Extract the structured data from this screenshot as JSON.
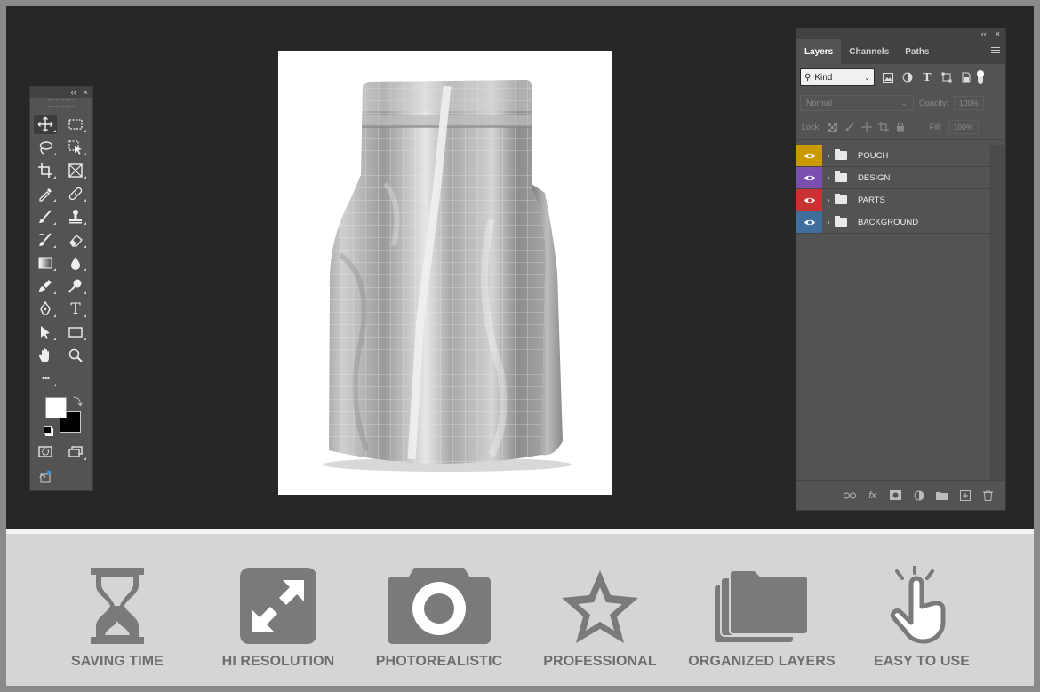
{
  "toolbar": {
    "collapse_glyph": "‹‹",
    "close_glyph": "×",
    "tools": [
      "move-tool",
      "rectangular-marquee-tool",
      "lasso-tool",
      "object-selection-tool",
      "crop-tool",
      "frame-tool",
      "eyedropper-tool",
      "spot-healing-tool",
      "brush-tool",
      "clone-stamp-tool",
      "history-brush-tool",
      "eraser-tool",
      "gradient-tool",
      "blur-tool",
      "smudge-tool",
      "dodge-tool",
      "pen-tool",
      "type-tool",
      "path-selection-tool",
      "rectangle-tool",
      "hand-tool",
      "zoom-tool",
      "edit-toolbar"
    ],
    "foreground_color": "#ffffff",
    "background_color": "#000000",
    "text_glyph": "T",
    "more_glyph": "•••"
  },
  "layers_panel": {
    "collapse_glyph": "‹‹",
    "close_glyph": "×",
    "tabs": [
      "Layers",
      "Channels",
      "Paths"
    ],
    "active_tab": "Layers",
    "filter_kind": "Kind",
    "filter_type_glyph": "T",
    "blend_mode": "Normal",
    "opacity_label": "Opacity:",
    "opacity_value": "100%",
    "lock_label": "Lock:",
    "fill_label": "Fill:",
    "fill_value": "100%",
    "layers": [
      {
        "name": "POUCH",
        "color": "#c99a00"
      },
      {
        "name": "DESIGN",
        "color": "#7a4fb0"
      },
      {
        "name": "PARTS",
        "color": "#c93232"
      },
      {
        "name": "BACKGROUND",
        "color": "#3f6e9c"
      }
    ],
    "footer_fx": "fx"
  },
  "features": [
    {
      "label": "SAVING TIME",
      "icon": "hourglass-icon"
    },
    {
      "label": "HI RESOLUTION",
      "icon": "expand-arrows-icon"
    },
    {
      "label": "PHOTOREALISTIC",
      "icon": "camera-icon"
    },
    {
      "label": "PROFESSIONAL",
      "icon": "star-icon"
    },
    {
      "label": "ORGANIZED LAYERS",
      "icon": "layers-stack-icon"
    },
    {
      "label": "EASY TO USE",
      "icon": "pointing-hand-icon"
    }
  ]
}
